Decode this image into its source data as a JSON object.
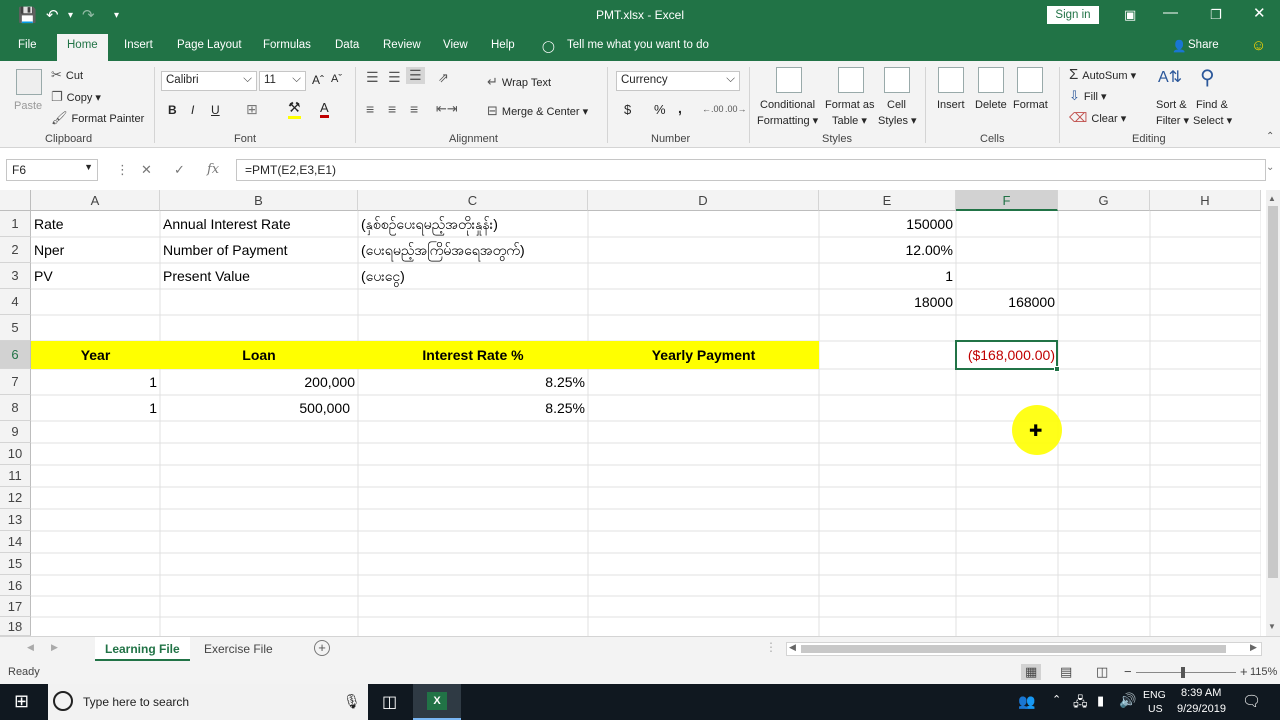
{
  "titlebar": {
    "title": "PMT.xlsx  -  Excel",
    "signin": "Sign in",
    "qa_save_icon": "save-icon",
    "qa_undo_icon": "undo-icon",
    "qa_redo_icon": "redo-icon",
    "qa_customize_icon": "customize-icon"
  },
  "tabs": {
    "file": "File",
    "home": "Home",
    "insert": "Insert",
    "page_layout": "Page Layout",
    "formulas": "Formulas",
    "data": "Data",
    "review": "Review",
    "view": "View",
    "help": "Help",
    "tell_me": "Tell me what you want to do",
    "share": "Share"
  },
  "ribbon": {
    "clipboard": {
      "paste": "Paste",
      "cut": "Cut",
      "copy": "Copy",
      "format_painter": "Format Painter",
      "label": "Clipboard"
    },
    "font": {
      "name": "Calibri",
      "size": "11",
      "bold": "B",
      "italic": "I",
      "underline": "U",
      "label": "Font"
    },
    "alignment": {
      "wrap_text": "Wrap Text",
      "merge_center": "Merge & Center",
      "label": "Alignment"
    },
    "number": {
      "format": "Currency",
      "dollar": "$",
      "percent": "%",
      "comma": ",",
      "label": "Number"
    },
    "styles": {
      "conditional": "Conditional",
      "conditional2": "Formatting",
      "format_as": "Format as",
      "format_as2": "Table",
      "cell": "Cell",
      "cell2": "Styles",
      "label": "Styles"
    },
    "cells": {
      "insert": "Insert",
      "delete": "Delete",
      "format": "Format",
      "label": "Cells"
    },
    "editing": {
      "autosum": "AutoSum",
      "fill": "Fill",
      "clear": "Clear",
      "sort": "Sort &",
      "sort2": "Filter",
      "find": "Find &",
      "find2": "Select",
      "label": "Editing"
    }
  },
  "formula_bar": {
    "name_box": "F6",
    "fx": "fx",
    "formula": "=PMT(E2,E3,E1)"
  },
  "columns": [
    "A",
    "B",
    "C",
    "D",
    "E",
    "F",
    "G",
    "H"
  ],
  "rows": [
    "1",
    "2",
    "3",
    "4",
    "5",
    "6",
    "7",
    "8",
    "9",
    "10",
    "11",
    "12",
    "13",
    "14",
    "15",
    "16",
    "17",
    "18"
  ],
  "cells": {
    "A1": "Rate",
    "B1": "Annual Interest Rate",
    "C1": "(နှစ်စဉ်ပေးရမည့်အတိုးနှုန်း)",
    "E1": "150000",
    "A2": "Nper",
    "B2": "Number of Payment",
    "C2": "(ပေးရမည့်အကြိမ်အရေအတွက်)",
    "E2": "12.00%",
    "A3": "PV",
    "B3": "Present Value",
    "C3": "(ပေးငွေ)",
    "E3": "1",
    "E4": "18000",
    "F4": "168000",
    "A6": "Year",
    "B6": "Loan",
    "C6": "Interest Rate %",
    "D6": "Yearly Payment",
    "F6": "($168,000.00)",
    "A7": "1",
    "B7": "200,000",
    "C7": "8.25%",
    "A8": "1",
    "B8": "500,000",
    "C8": "8.25%"
  },
  "sheets": {
    "active": "Learning File",
    "other": "Exercise File"
  },
  "status": {
    "ready": "Ready",
    "zoom": "115%"
  },
  "taskbar": {
    "search": "Type here to search",
    "lang1": "ENG",
    "lang2": "US",
    "time": "8:39 AM",
    "date": "9/29/2019"
  },
  "colors": {
    "excel_green": "#217346",
    "header_yellow": "#ffff00",
    "negative_red": "#c00000"
  }
}
